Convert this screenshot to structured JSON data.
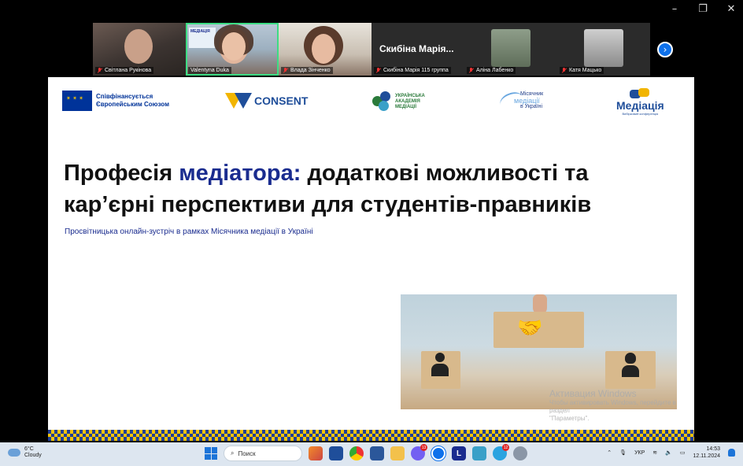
{
  "window": {
    "controls": [
      "–",
      "❐",
      "✕"
    ]
  },
  "participants": [
    {
      "name": "Світлана Рукінова",
      "muted": true
    },
    {
      "name": "Valentyna Duka",
      "muted": false,
      "active_speaker": true,
      "screen_text": "МЕДІАЦІЯ"
    },
    {
      "name": "Влада Зінченко",
      "muted": true
    },
    {
      "name": "Скибіна Марія 115 группа",
      "display_title": "Скибіна Марія...",
      "muted": true
    },
    {
      "name": "Аліна Лабенко",
      "muted": true
    },
    {
      "name": "Катя Мацько",
      "muted": true
    }
  ],
  "next_page_icon": "chevron-right-icon",
  "slide": {
    "eu_logo": {
      "line1": "Співфінансується",
      "line2": "Європейським Союзом"
    },
    "consent_logo": "CONSENT",
    "academy_logo": {
      "line1": "УКРАЇНСЬКА",
      "line2": "АКАДЕМІЯ",
      "line3": "МЕДІАЦІЇ"
    },
    "month_logo": {
      "line1": "Місячник",
      "line2": "медіації",
      "line3": "в Україні"
    },
    "mediation_logo": {
      "title": "Медіація",
      "subtitle": "Вибірковий конференція"
    },
    "title_part1": "Професія ",
    "title_highlight": "медіатора:",
    "title_part2": " додаткові можливості та",
    "title_line2": "кар’єрні перспективи для студентів-правників",
    "subtitle": "Просвітницька онлайн-зустріч в рамках Місячника медіації в Україні"
  },
  "watermark": {
    "title": "Активация Windows",
    "line2": "Чтобы активировать Windows, перейдите в раздел",
    "line3": "\"Параметры\"."
  },
  "taskbar": {
    "weather_temp": "6°C",
    "weather_desc": "Cloudy",
    "search_placeholder": "Поиск",
    "badges": {
      "viber": "13",
      "telegram": "12"
    },
    "lang": "УКР",
    "time": "14:53",
    "date": "12.11.2024"
  },
  "colors": {
    "accent": "#1a2c8f",
    "speaker_outline": "#3ddc84",
    "zoom_blue": "#0e71eb"
  }
}
